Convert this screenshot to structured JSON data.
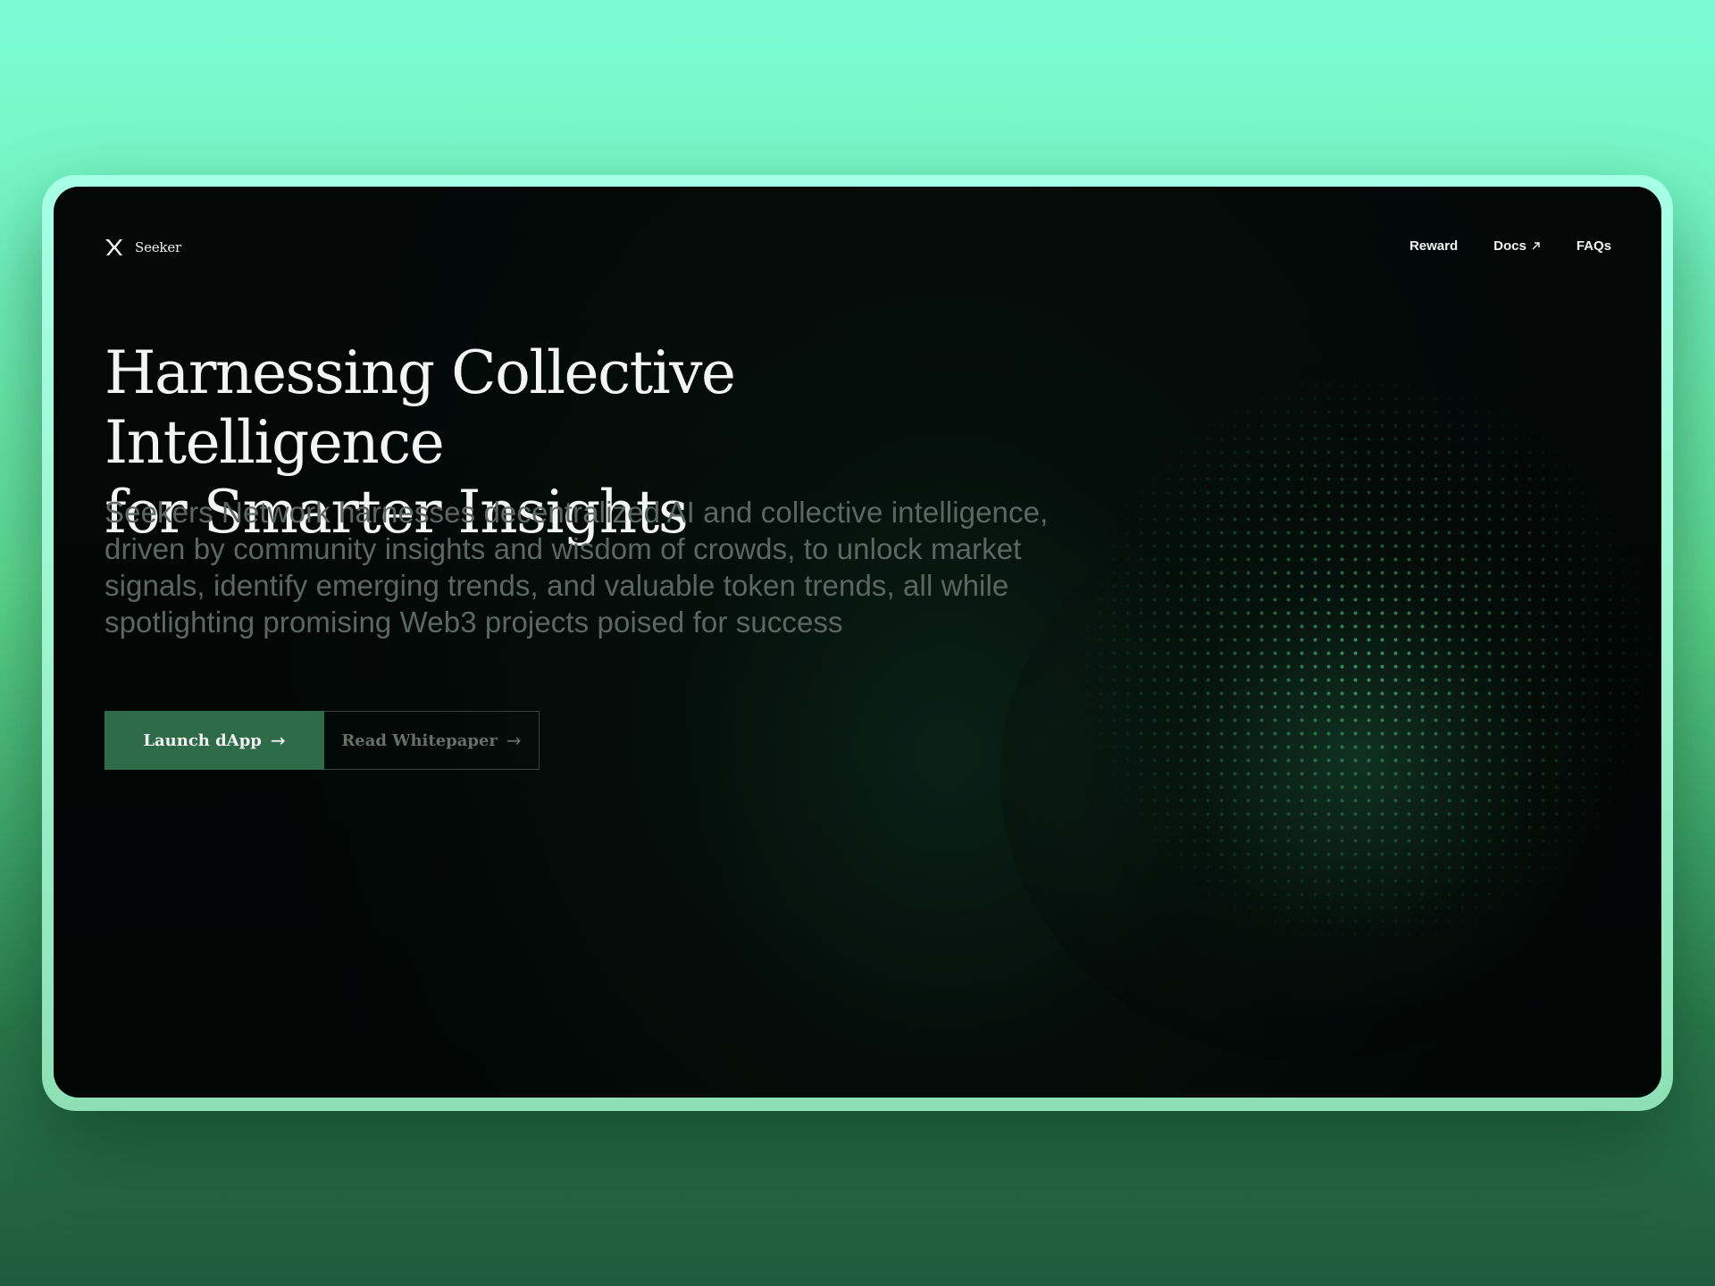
{
  "brand": {
    "name": "Seeker",
    "logo_icon": "x-mark-logo-icon"
  },
  "nav": {
    "items": [
      {
        "label": "Reward",
        "icon": null
      },
      {
        "label": "Docs",
        "icon": "external-arrow-icon"
      },
      {
        "label": "FAQs",
        "icon": null
      }
    ]
  },
  "hero": {
    "title_line1": "Harnessing Collective Intelligence",
    "title_line2": "for Smarter Insights",
    "description": "Seekers Network harnesses decentralized AI and collective intelligence, driven by community insights and wisdom of crowds, to unlock market signals, identify emerging trends, and valuable token trends, all while spotlighting promising Web3 projects poised for success"
  },
  "actions": {
    "primary_label": "Launch dApp",
    "secondary_label": "Read Whitepaper",
    "arrow_glyph": "→"
  },
  "colors": {
    "accent": "#2e6b48",
    "background": "#020605",
    "frame": "#9ef3cf"
  }
}
